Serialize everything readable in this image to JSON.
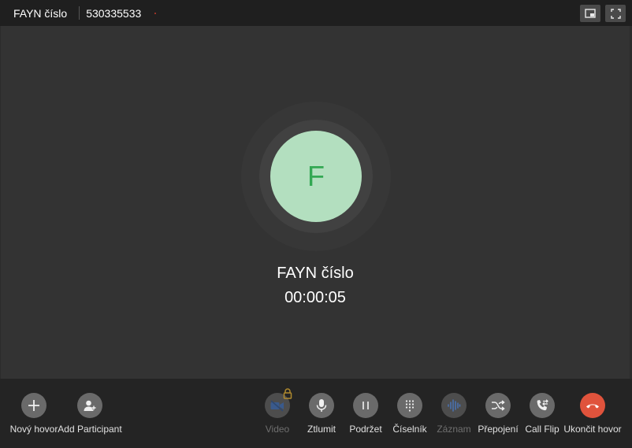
{
  "header": {
    "caller_name": "FAYN číslo",
    "caller_number": "530335533",
    "pip_icon": "picture-in-picture-icon",
    "fullscreen_icon": "fullscreen-icon"
  },
  "call": {
    "avatar_initial": "F",
    "name": "FAYN číslo",
    "duration": "00:00:05"
  },
  "toolbar": {
    "new_call": "Nový hovor",
    "add_participant": "Add Participant",
    "video": "Video",
    "mute": "Ztlumit",
    "hold": "Podržet",
    "dialpad": "Číselník",
    "record": "Záznam",
    "transfer": "Přepojení",
    "call_flip": "Call Flip",
    "end_call": "Ukončit hovor"
  },
  "colors": {
    "avatar_bg": "#b3dfbf",
    "avatar_text": "#33a853",
    "end_call": "#e0533c",
    "video_icon": "#3a5a8c",
    "record_icon": "#4a72b0",
    "lock_icon": "#b08a2e"
  }
}
